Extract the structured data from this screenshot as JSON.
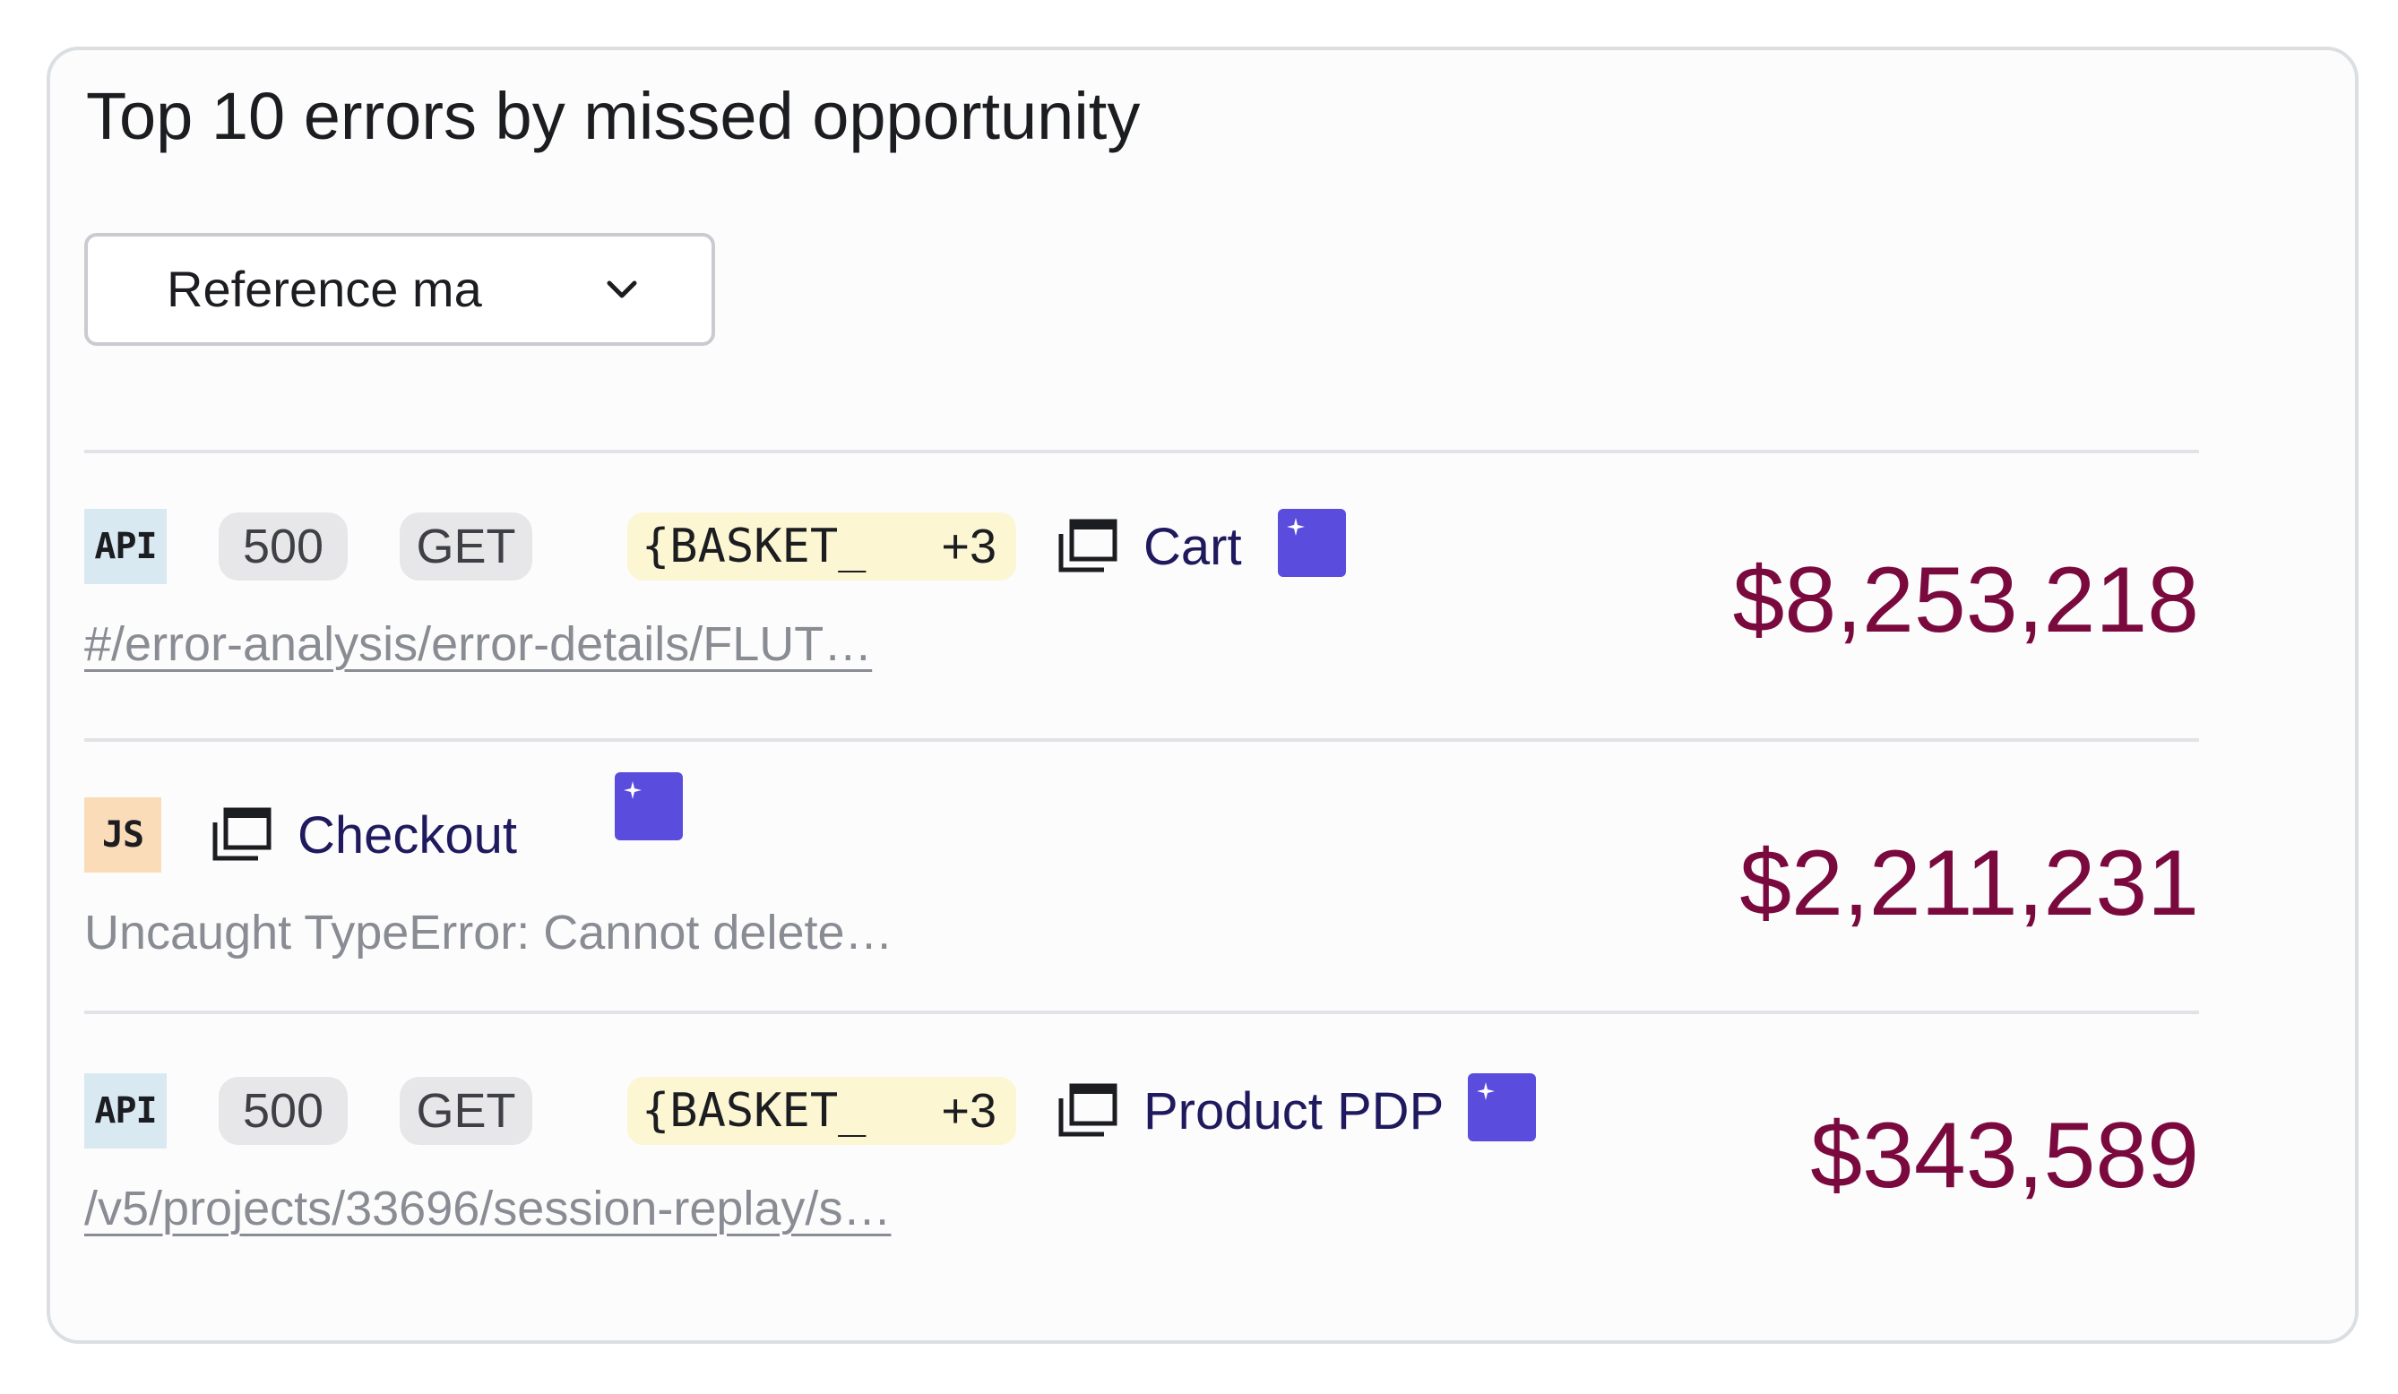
{
  "widget": {
    "title": "Top 10 errors by missed opportunity",
    "filter": {
      "selected": "Reference ma",
      "chevron_icon": "chevron-down-icon"
    }
  },
  "errors": [
    {
      "badge": "API",
      "status": "500",
      "method": "GET",
      "param_tag": "{BASKET_",
      "param_extra": "+3",
      "page_icon": "page-stack-icon",
      "page": "Cart",
      "ai_icon": "sparkle-icon",
      "detail": "#/error-analysis/error-details/FLUT…",
      "amount": "$8,253,218"
    },
    {
      "badge": "JS",
      "page_icon": "page-stack-icon",
      "page": "Checkout",
      "ai_icon": "sparkle-icon",
      "detail": "Uncaught TypeError: Cannot delete…",
      "amount": "$2,211,231"
    },
    {
      "badge": "API",
      "status": "500",
      "method": "GET",
      "param_tag": "{BASKET_",
      "param_extra": "+3",
      "page_icon": "page-stack-icon",
      "page": "Product PDP",
      "ai_icon": "sparkle-icon",
      "detail": "/v5/projects/33696/session-replay/s…",
      "amount": "$343,589"
    }
  ],
  "colors": {
    "amount": "#7a0a3e",
    "page_link": "#1f1a5e",
    "ai_button": "#5a4cdc",
    "api_badge": "#d9e9f2",
    "js_badge": "#fbdcb8",
    "param_tag": "#fcf6d2"
  }
}
